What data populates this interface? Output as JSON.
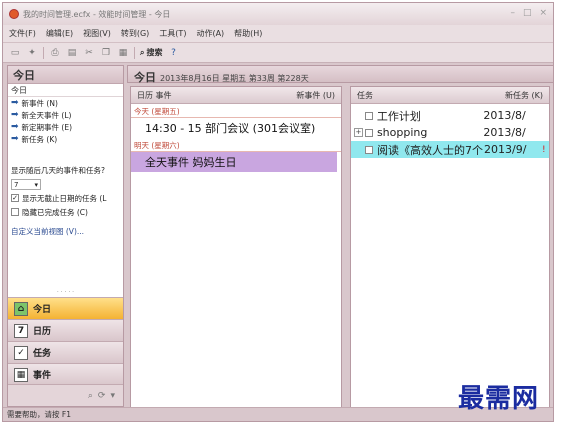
{
  "window": {
    "title": "我的时间管理.ecfx - 效能时间管理 - 今日",
    "controls": [
      "–",
      "□",
      "×"
    ]
  },
  "menu": [
    "文件(F)",
    "编辑(E)",
    "视图(V)",
    "转到(G)",
    "工具(T)",
    "动作(A)",
    "帮助(H)"
  ],
  "toolbar": {
    "search_label": "搜索"
  },
  "nav": {
    "header": "今日",
    "sub": "今日",
    "links": [
      "新事件 (N)",
      "新全天事件 (L)",
      "新定期事件 (E)",
      "新任务 (K)"
    ],
    "question": "显示随后几天的事件和任务?",
    "days_value": "7",
    "checks": [
      {
        "label": "显示无截止日期的任务 (L",
        "checked": true
      },
      {
        "label": "隐藏已完成任务 (C)",
        "checked": false
      }
    ],
    "custom_view": "自定义当前视图 (V)...",
    "buttons": [
      "今日",
      "日历",
      "任务",
      "事件"
    ]
  },
  "main": {
    "title": "今日",
    "date": "2013年8月16日 星期五 第33周 第228天"
  },
  "calendar": {
    "head_left": "日历 事件",
    "head_right": "新事件 (U)",
    "days": [
      {
        "label": "今天 (星期五)",
        "event": "14:30 - 15 部门会议 (301会议室)"
      },
      {
        "label": "明天 (星期六)",
        "event": "全天事件   妈妈生日"
      }
    ]
  },
  "tasks": {
    "head_left": "任务",
    "head_right": "新任务 (K)",
    "rows": [
      {
        "name": "工作计划",
        "date": "2013/8/",
        "expander": "",
        "flag": ""
      },
      {
        "name": "shopping",
        "date": "2013/8/",
        "expander": "+",
        "flag": ""
      },
      {
        "name": "阅读《高效人士的7个",
        "date": "2013/9/",
        "expander": "",
        "flag": "!"
      }
    ]
  },
  "status": "需要帮助，请按 F1",
  "watermark": "最需网"
}
